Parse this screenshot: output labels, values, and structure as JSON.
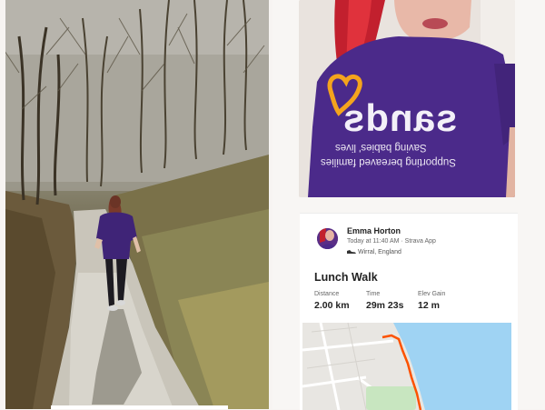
{
  "selfie": {
    "shirt_logo_text": "sands",
    "shirt_tagline_1": "Saving babies' lives",
    "shirt_tagline_2": "Supporting bereaved families"
  },
  "activity": {
    "user_name": "Emma Horton",
    "meta": "Today at 11:40 AM · Strava App",
    "location": "Wirral, England",
    "title": "Lunch Walk",
    "stats": [
      {
        "label": "Distance",
        "value": "2.00 km"
      },
      {
        "label": "Time",
        "value": "29m 23s"
      },
      {
        "label": "Elev Gain",
        "value": "12 m"
      }
    ]
  },
  "colors": {
    "route": "#fc5200",
    "water": "#9fd3f3",
    "park": "#c8e6c0",
    "shirt": "#4b2a8a",
    "heart_logo": "#f4a41d"
  }
}
